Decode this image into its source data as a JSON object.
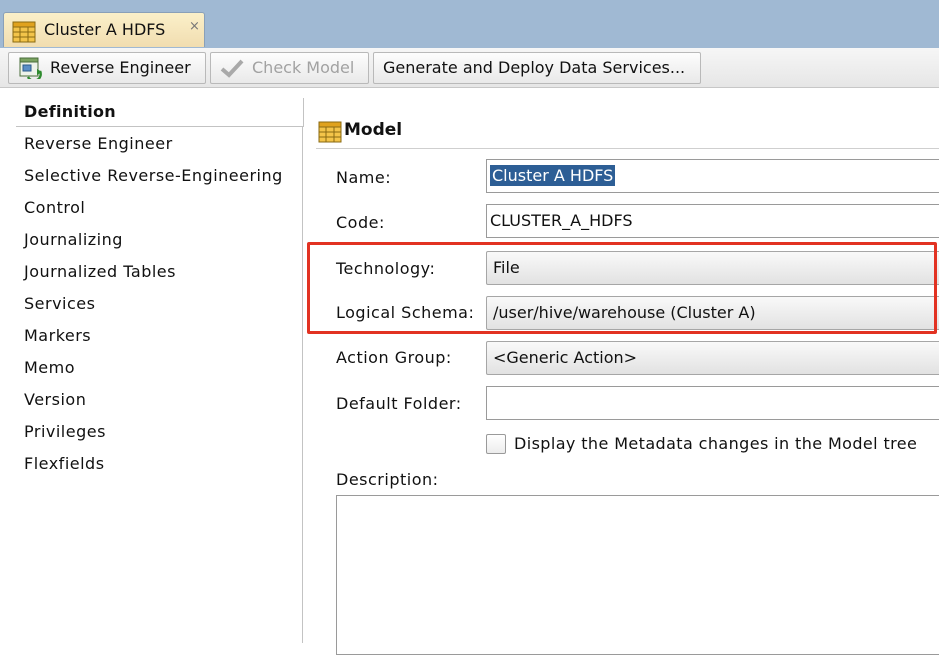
{
  "tab": {
    "title": "Cluster A HDFS",
    "close": "×"
  },
  "toolbar": {
    "reverse_engineer": "Reverse Engineer",
    "check_model": "Check Model",
    "generate_deploy": "Generate and Deploy Data Services..."
  },
  "sidebar": {
    "items": [
      "Definition",
      "Reverse Engineer",
      "Selective Reverse-Engineering",
      "Control",
      "Journalizing",
      "Journalized Tables",
      "Services",
      "Markers",
      "Memo",
      "Version",
      "Privileges",
      "Flexfields"
    ],
    "active_index": 0
  },
  "panel": {
    "title": "Model",
    "fields": {
      "name": {
        "label": "Name:",
        "value": "Cluster A HDFS"
      },
      "code": {
        "label": "Code:",
        "value": "CLUSTER_A_HDFS"
      },
      "technology": {
        "label": "Technology:",
        "value": "File"
      },
      "logical_schema": {
        "label": "Logical Schema:",
        "value": "/user/hive/warehouse (Cluster A)"
      },
      "action_group": {
        "label": "Action Group:",
        "value": "<Generic Action>"
      },
      "default_folder": {
        "label": "Default Folder:",
        "value": ""
      }
    },
    "display_metadata_checkbox": {
      "label": "Display the Metadata changes in the Model tree",
      "checked": false
    },
    "description_label": "Description:"
  },
  "colors": {
    "top_bar": "#a0b9d3",
    "highlight_border": "#e23222",
    "selection": "#2d5e95"
  },
  "icons": {
    "tab": "model-table-icon",
    "reverse_engineer": "reverse-engineer-icon",
    "check_model": "checkmark-icon",
    "panel_title": "model-table-icon"
  }
}
